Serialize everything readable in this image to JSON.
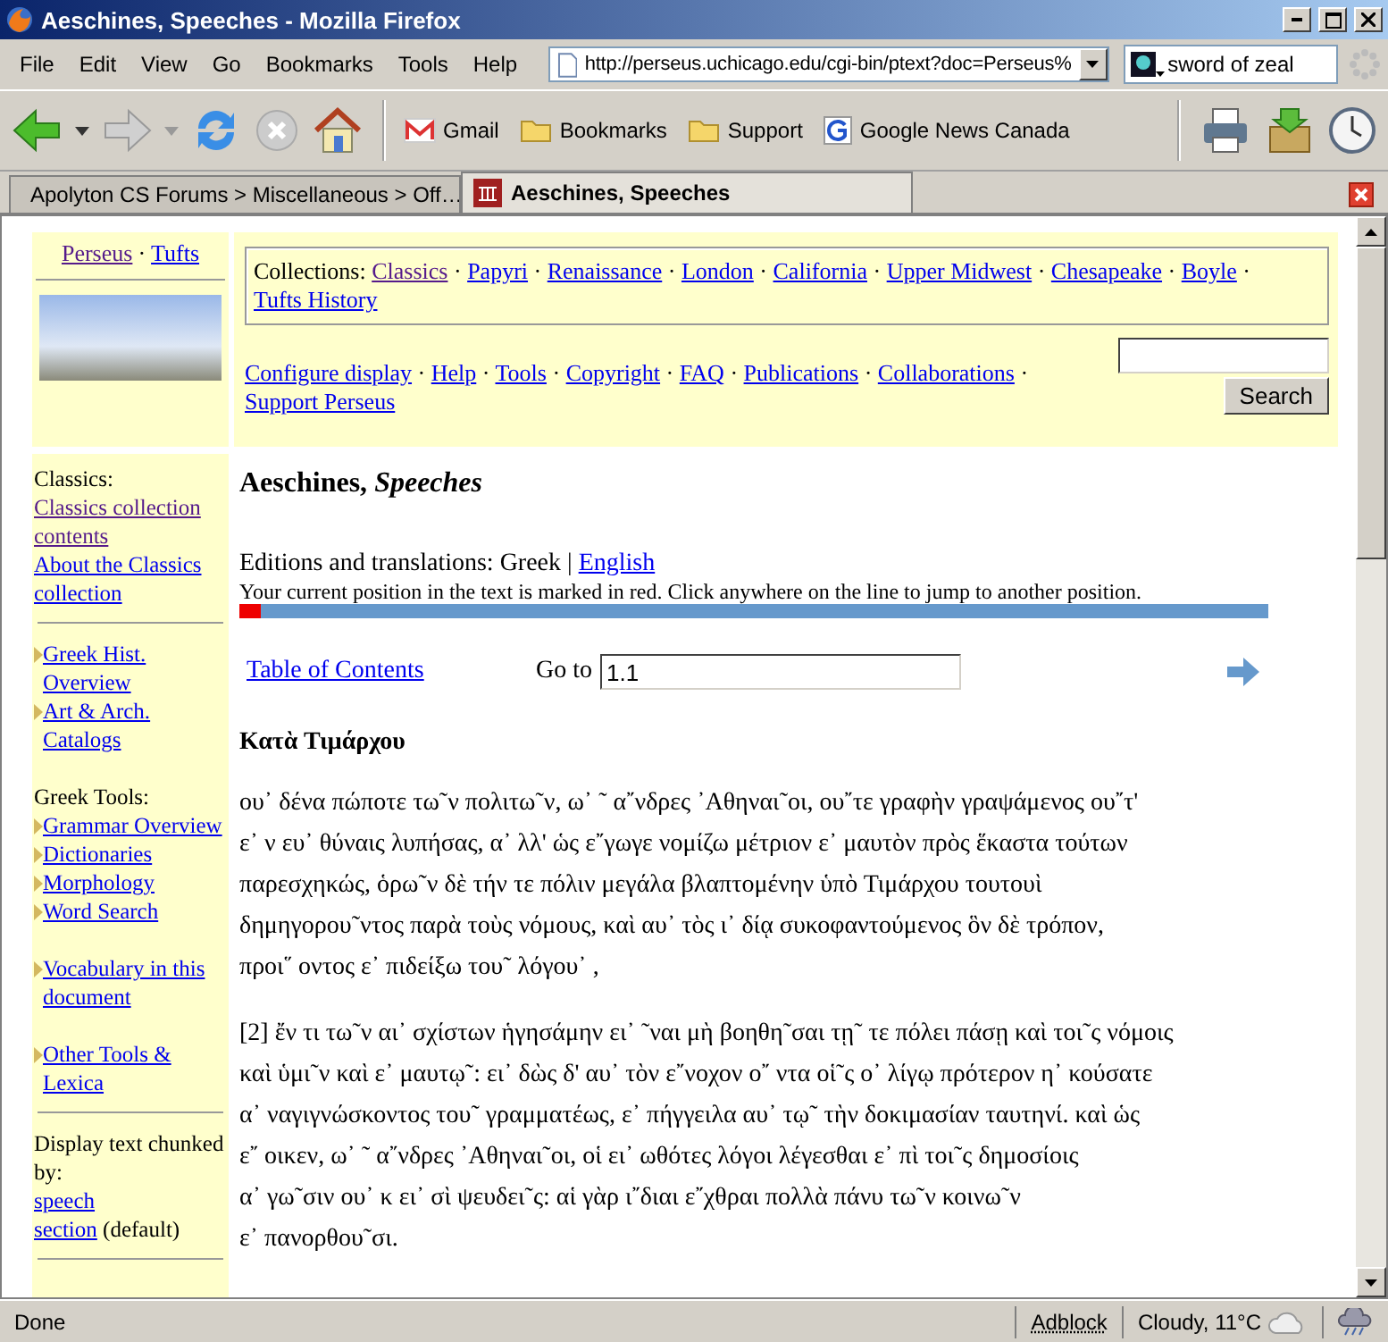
{
  "window": {
    "title": "Aeschines, Speeches - Mozilla Firefox"
  },
  "menu": [
    "File",
    "Edit",
    "View",
    "Go",
    "Bookmarks",
    "Tools",
    "Help"
  ],
  "address": {
    "value": "http://perseus.uchicago.edu/cgi-bin/ptext?doc=Perseus%"
  },
  "search_box": {
    "value": "sword of zeal"
  },
  "bookmarks": [
    {
      "kind": "mail",
      "label": "Gmail"
    },
    {
      "kind": "folder",
      "label": "Bookmarks"
    },
    {
      "kind": "folder",
      "label": "Support"
    },
    {
      "kind": "news",
      "label": "Google News Canada"
    }
  ],
  "tabs": [
    {
      "label": "Apolyton CS Forums > Miscellaneous > Off…",
      "selected": false
    },
    {
      "label": "Aeschines, Speeches",
      "selected": true
    }
  ],
  "sidebar": {
    "top_links": [
      {
        "text": "Perseus",
        "visited": true
      },
      {
        "sep": "·",
        "text": "Tufts",
        "visited": false
      }
    ],
    "items": [
      {
        "kind": "text",
        "text": "Classics:"
      },
      {
        "kind": "link",
        "text": "Classics collection contents",
        "visited": true
      },
      {
        "kind": "link",
        "text": "About the Classics collection",
        "visited": false
      },
      {
        "kind": "rule"
      },
      {
        "kind": "arrow_link",
        "text": "Greek Hist. Overview",
        "visited": false
      },
      {
        "kind": "arrow_link",
        "text": "Art & Arch. Catalogs",
        "visited": false
      },
      {
        "kind": "gap"
      },
      {
        "kind": "text",
        "text": "Greek Tools:"
      },
      {
        "kind": "arrow_link",
        "text": "Grammar Overview",
        "visited": false
      },
      {
        "kind": "arrow_link",
        "text": "Dictionaries",
        "visited": false
      },
      {
        "kind": "arrow_link",
        "text": "Morphology",
        "visited": false
      },
      {
        "kind": "arrow_link",
        "text": "Word Search",
        "visited": false
      },
      {
        "kind": "gap"
      },
      {
        "kind": "arrow_link",
        "text": "Vocabulary in this document",
        "visited": false
      },
      {
        "kind": "gap"
      },
      {
        "kind": "arrow_link",
        "text": "Other Tools & Lexica",
        "visited": false
      },
      {
        "kind": "rule"
      },
      {
        "kind": "text",
        "text": "Display text chunked by:"
      },
      {
        "kind": "link",
        "text": "speech",
        "visited": false
      },
      {
        "kind": "link_note",
        "text": "section",
        "note": "(default)",
        "visited": false
      },
      {
        "kind": "rule"
      }
    ]
  },
  "header": {
    "collections_label": "Collections:",
    "collections": [
      {
        "text": "Classics",
        "visited": true
      },
      {
        "sep": "·",
        "text": "Papyri",
        "visited": false
      },
      {
        "sep": "·",
        "text": "Renaissance",
        "visited": false
      },
      {
        "sep": "·",
        "text": "London",
        "visited": false
      },
      {
        "sep": "·",
        "text": "California",
        "visited": false
      },
      {
        "sep": "·",
        "text": "Upper Midwest",
        "visited": false
      },
      {
        "sep": "·",
        "text": "Chesapeake",
        "visited": false
      },
      {
        "sep": "·",
        "text": "Boyle",
        "visited": false
      },
      {
        "sep": "·",
        "text": "Tufts History",
        "visited": false
      }
    ],
    "nav_links": [
      {
        "text": "Configure display"
      },
      {
        "sep": "·",
        "text": "Help"
      },
      {
        "sep": "·",
        "text": "Tools"
      },
      {
        "sep": "·",
        "text": "Copyright"
      },
      {
        "sep": "·",
        "text": "FAQ"
      },
      {
        "sep": "·",
        "text": "Publications"
      },
      {
        "sep": "·",
        "text": "Collaborations"
      },
      {
        "sep": "·",
        "text": "Support Perseus"
      }
    ],
    "search_button": "Search"
  },
  "main": {
    "title": "Aeschines, *Speeches*",
    "editions_label": "Editions and translations: Greek |",
    "editions_link": "English",
    "position_note": "Your current position in the text is marked in red. Click anywhere on the line to jump to another position.",
    "position": {
      "level": 0.02
    },
    "toc_link": "Table of Contents",
    "goto_label": "Go to",
    "goto_value": "1.1",
    "section_heading": "Κατὰ Τιμάρχου",
    "paragraphs": [
      {
        "lines": [
          "ου᾿ δένα πώποτε τω῀ν πολιτω῀ν, ω᾿ ῀ α῎νδρες  ᾿Αθηναι῀οι, ου῎τε γραφὴν γραψάμενος ου῎τ'",
          "ε᾿ ν ευ᾿ θύναις λυπήσας, α᾿ λλ' ὡς ε῎γωγε νομίζω μέτριον ε᾿ μαυτὸν πρὸς ἕκαστα τούτων",
          "παρεσχηκώς, ὁρω῀ν δὲ τήν τε πόλιν μεγάλα βλαπτομένην ὑπὸ Τιμάρχου τουτουὶ",
          "δημηγορου῀ντος παρὰ τοὺς νόμους, καὶ αυ᾿ τὸς ι᾿ δίᾳ συκοφαντούμενος ὃν δὲ τρόπον,",
          "προι῞ οντος ε᾿ πιδείξω του῀ λόγου᾿ ,"
        ]
      },
      {
        "lines": [
          "[2] ἔν τι τω῀ν αι᾿ σχίστων ἡγησάμην ει᾿ ῀ναι μὴ βοηθη῀σαι τῃ῀ τε πόλει πάσῃ καὶ τοι῀ς νόμοις",
          "καὶ ὑμι῀ν καὶ ε᾿ μαυτῳ῀: ει᾿ δὼς δ' αυ᾿ τὸν ε῎νοχον ο῎ ντα οἱ῀ς ο᾿ λίγῳ πρότερον η᾿ κούσατε",
          "α᾿ ναγιγνώσκοντος του῀ γραμματέως, ε᾿ πήγγειλα αυ᾿ τῳ῀ τὴν δοκιμασίαν ταυτηνί. καὶ ὡς",
          "ε῎ οικεν, ω᾿ ῀ α῎νδρες  ᾿Αθηναι῀οι, οἱ ει᾿ ωθότες λόγοι λέγεσθαι ε᾿ πὶ τοι῀ς δημοσίοις",
          "α᾿ γω῀σιν ου᾿ κ ει᾿ σὶ ψευδει῀ς: αἱ γὰρ ι῎διαι ε῎χθραι πολλὰ πάνυ τω῀ν κοινω῀ν",
          "ε᾿ πανορθου῀σι."
        ]
      }
    ]
  },
  "status_bar": {
    "text": "Done",
    "adblock": "Adblock",
    "weather": "Cloudy, 11°C"
  }
}
